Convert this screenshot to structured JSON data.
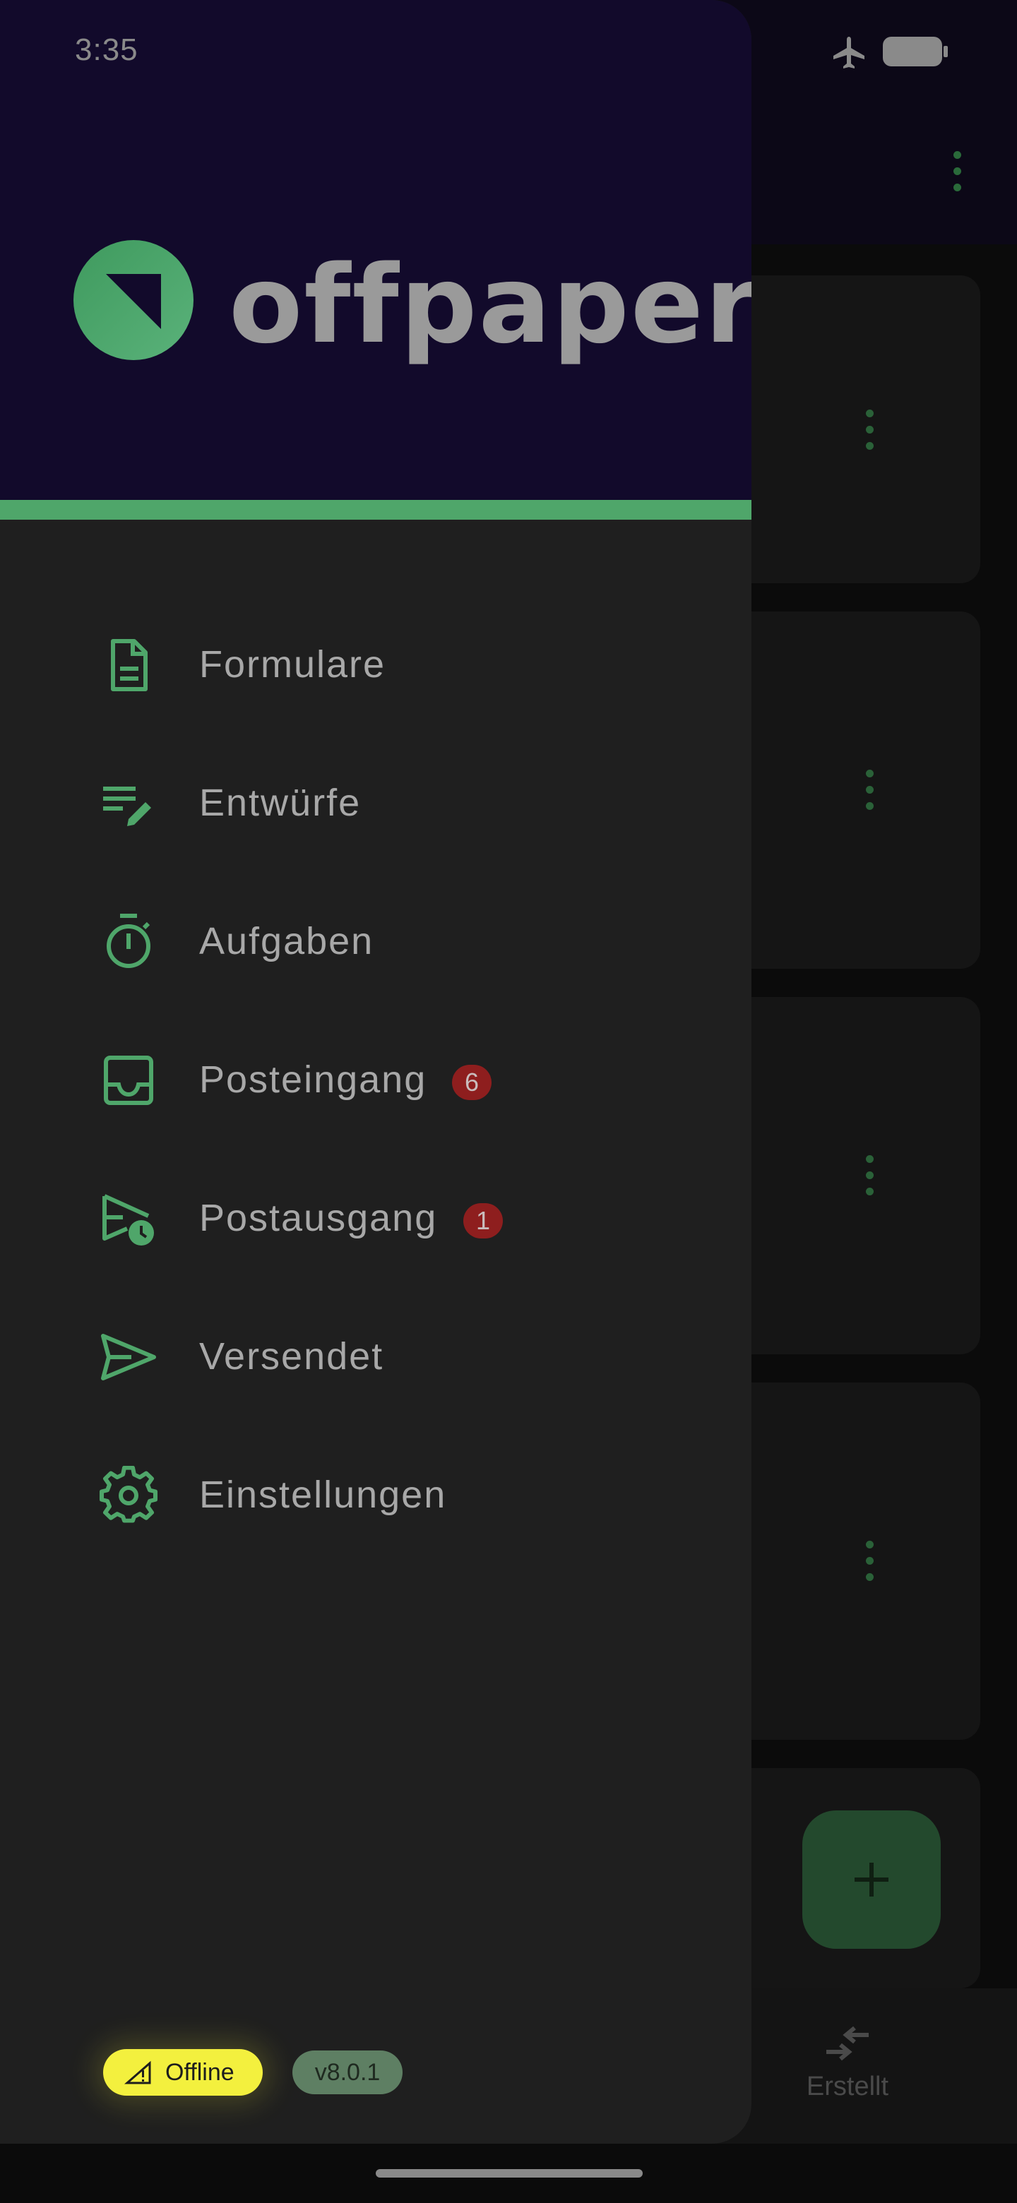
{
  "status_bar": {
    "time": "3:35"
  },
  "brand": {
    "name": "offpaper",
    "accent_color": "#4fa66a",
    "header_color": "#120a2b"
  },
  "drawer": {
    "items": [
      {
        "label": "Formulare",
        "icon": "document-icon"
      },
      {
        "label": "Entwürfe",
        "icon": "edit-list-icon"
      },
      {
        "label": "Aufgaben",
        "icon": "timer-icon"
      },
      {
        "label": "Posteingang",
        "icon": "inbox-icon",
        "badge": "6"
      },
      {
        "label": "Postausgang",
        "icon": "send-scheduled-icon",
        "badge": "1"
      },
      {
        "label": "Versendet",
        "icon": "send-icon"
      },
      {
        "label": "Einstellungen",
        "icon": "gear-icon"
      }
    ],
    "offline_label": "Offline",
    "version": "v8.0.1"
  },
  "background": {
    "bottom_nav_label": "Erstellt"
  }
}
